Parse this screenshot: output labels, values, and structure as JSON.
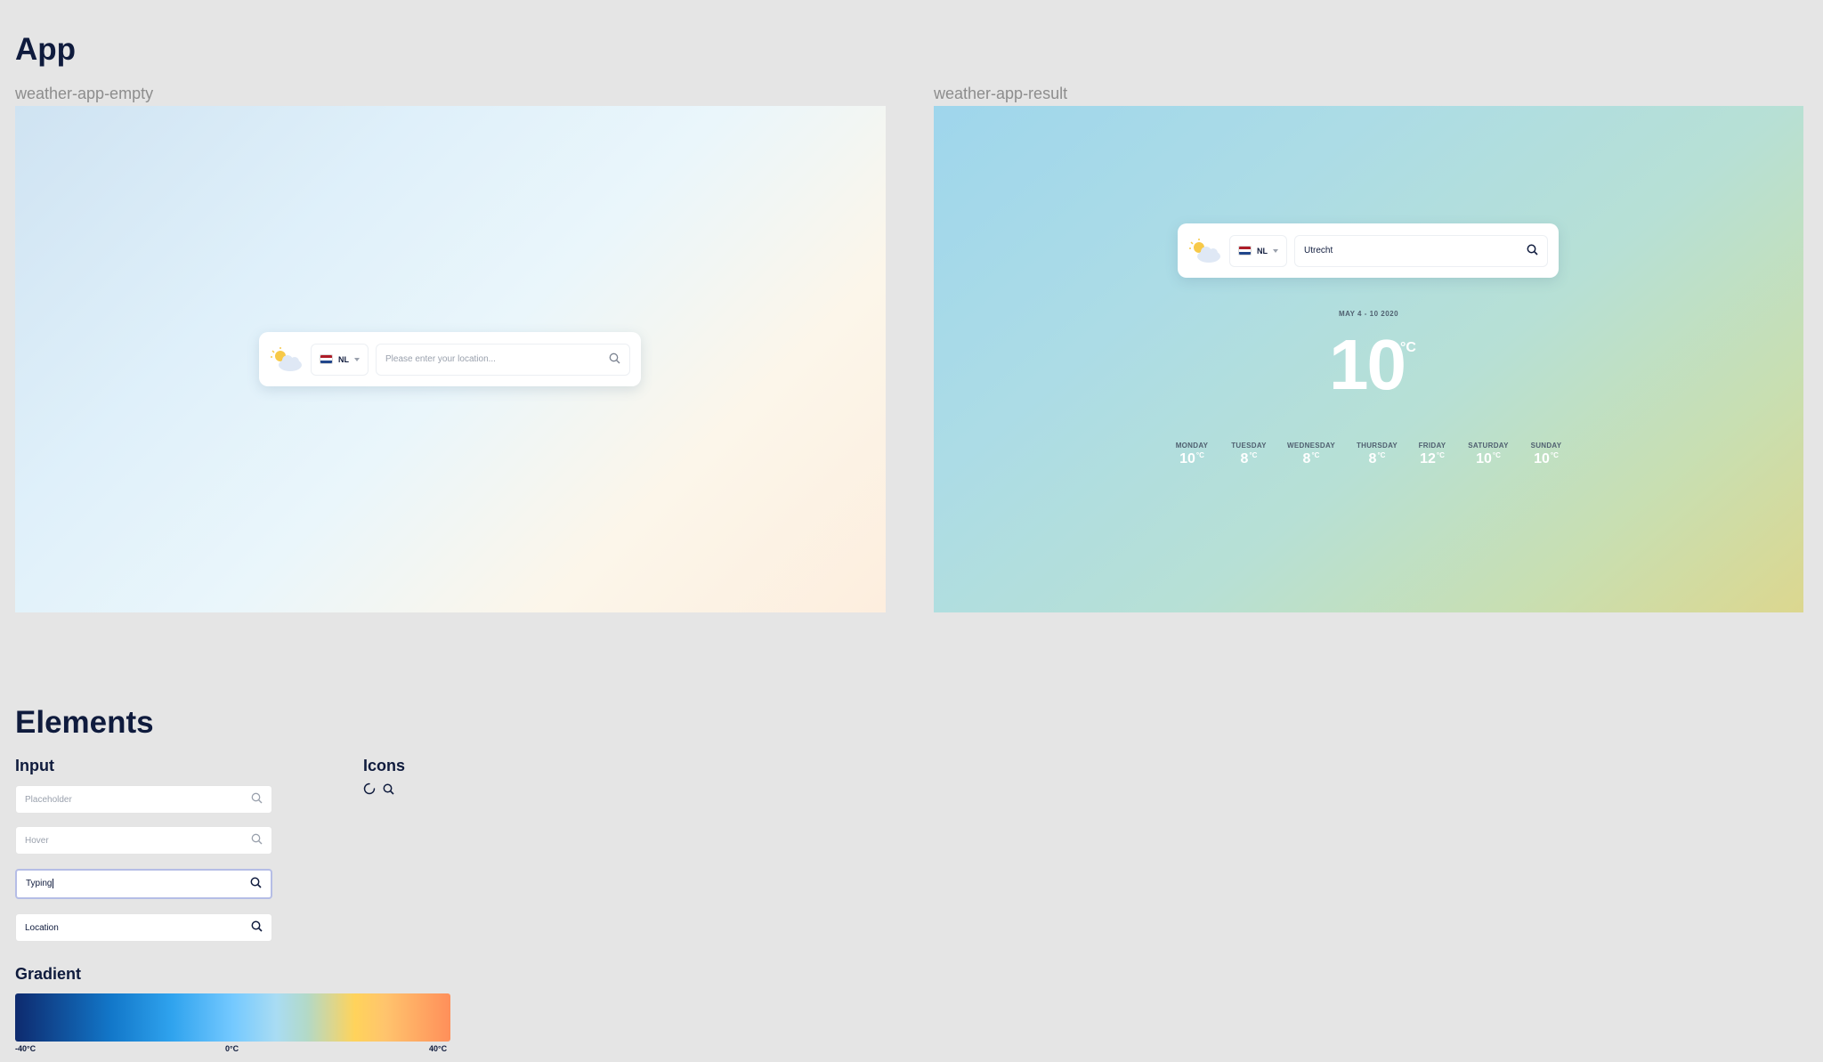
{
  "app_section": {
    "title": "App",
    "frames": {
      "empty_label": "weather-app-empty",
      "result_label": "weather-app-result"
    }
  },
  "empty_app": {
    "country": "NL",
    "placeholder": "Please enter your location..."
  },
  "result_app": {
    "country": "NL",
    "location": "Utrecht",
    "date_range": "MAY 4 - 10 2020",
    "temperature": "10",
    "unit": "°C",
    "days": [
      {
        "name": "MONDAY",
        "temp": "10"
      },
      {
        "name": "TUESDAY",
        "temp": "8"
      },
      {
        "name": "WEDNESDAY",
        "temp": "8"
      },
      {
        "name": "THURSDAY",
        "temp": "8"
      },
      {
        "name": "FRIDAY",
        "temp": "12"
      },
      {
        "name": "SATURDAY",
        "temp": "10"
      },
      {
        "name": "SUNDAY",
        "temp": "10"
      }
    ]
  },
  "elements_section": {
    "title": "Elements",
    "input_heading": "Input",
    "icons_heading": "Icons",
    "gradient_heading": "Gradient",
    "inputs": {
      "placeholder": "Placeholder",
      "hover": "Hover",
      "typing": "Typing",
      "location": "Location"
    },
    "gradient_labels": {
      "min": "-40°C",
      "mid": "0°C",
      "max": "40°C"
    }
  },
  "colors": {
    "heading": "#0f1b3d",
    "background": "#e5e5e5",
    "sun": "#f7c948",
    "cloud": "#dfe8f5"
  }
}
